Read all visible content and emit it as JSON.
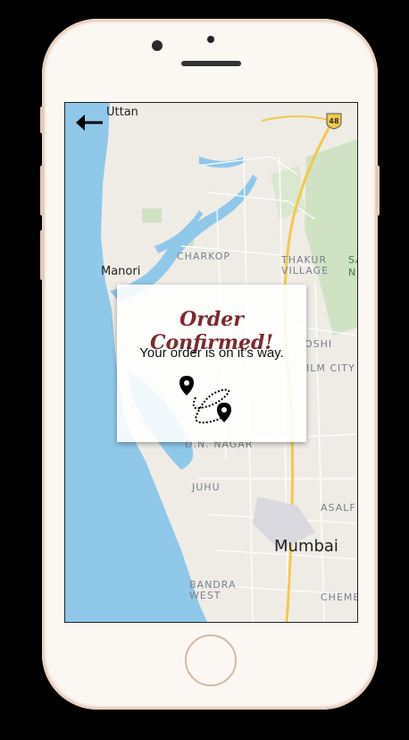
{
  "map": {
    "labels": {
      "uttan": "Uttan",
      "manori": "Manori",
      "charkop": "CHARKOP",
      "thakur_village": "THAKUR\nVILLAGE",
      "sa": "SA",
      "n": "N",
      "oshi": "OSHI",
      "ilm_city": "ILM CITY",
      "dn_nagar": "D.N. NAGAR",
      "juhu": "JUHU",
      "asalf": "ASALF",
      "mumbai": "Mumbai",
      "bandra_west": "BANDRA\nWEST",
      "cheme": "CHEME",
      "highway": "48"
    }
  },
  "overlay": {
    "title": "Order Confirmed!",
    "subtitle": "Your order is on it’s way."
  },
  "icons": {
    "back": "back-arrow-icon",
    "route": "route-icon",
    "pin": "location-pin-icon"
  },
  "colors": {
    "phone_body": "#fbf7f3",
    "phone_trim": "#e9d2c0",
    "water": "#90c8e9",
    "land": "#efece6",
    "park": "#cfe3c4",
    "highway": "#f2c94c",
    "title": "#7c2a2f"
  }
}
